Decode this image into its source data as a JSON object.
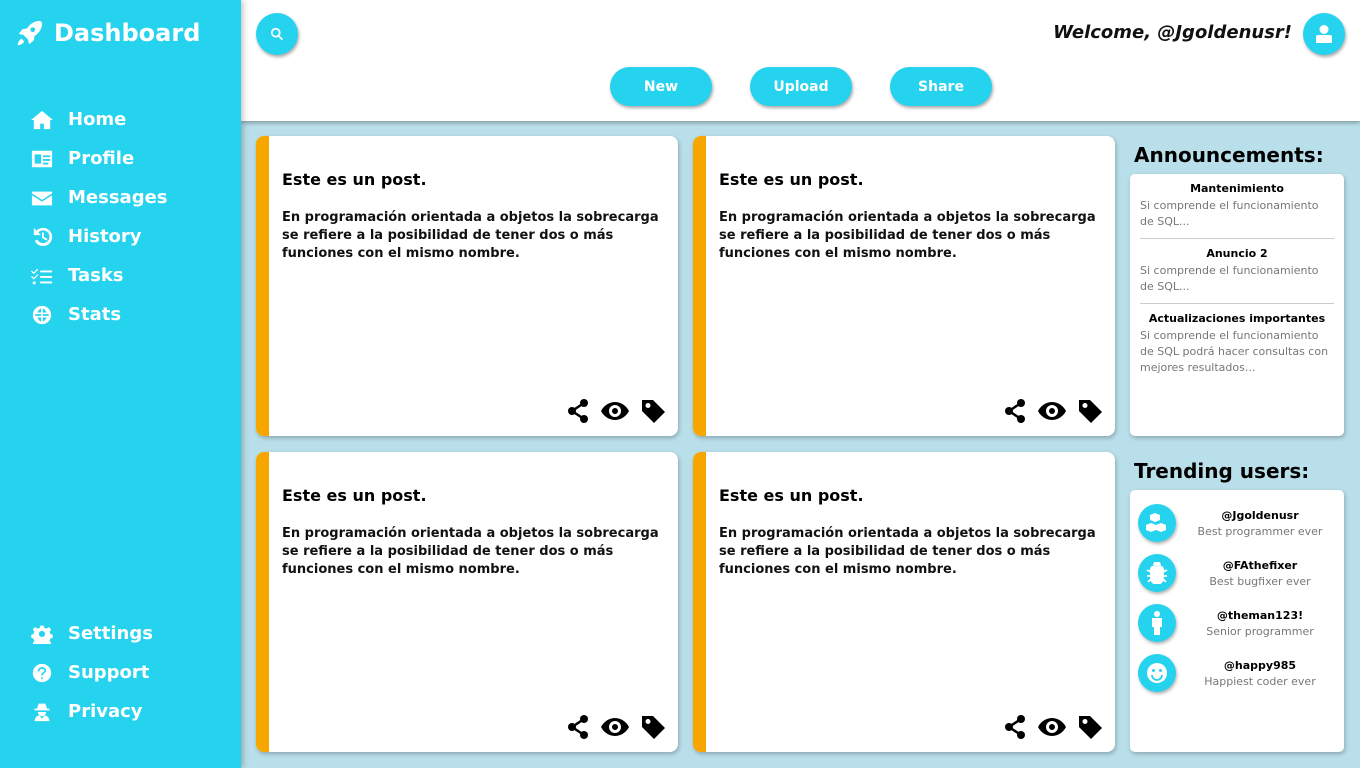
{
  "sidebar": {
    "brand": "Dashboard",
    "items": [
      {
        "label": "Home",
        "icon": "home-icon"
      },
      {
        "label": "Profile",
        "icon": "id-card-icon"
      },
      {
        "label": "Messages",
        "icon": "envelope-icon"
      },
      {
        "label": "History",
        "icon": "history-icon"
      },
      {
        "label": "Tasks",
        "icon": "tasks-icon"
      },
      {
        "label": "Stats",
        "icon": "globe-icon"
      }
    ],
    "bottom_items": [
      {
        "label": "Settings",
        "icon": "gear-icon"
      },
      {
        "label": "Support",
        "icon": "question-icon"
      },
      {
        "label": "Privacy",
        "icon": "user-secret-icon"
      }
    ]
  },
  "header": {
    "welcome": "Welcome, @Jgoldenusr!",
    "buttons": [
      "New",
      "Upload",
      "Share"
    ]
  },
  "posts": [
    {
      "title": "Este es un post.",
      "body": "En programación orientada a objetos la sobrecarga se refiere a la posibilidad de tener dos o más funciones con el mismo nombre."
    },
    {
      "title": "Este es un post.",
      "body": "En programación orientada a objetos la sobrecarga se refiere a la posibilidad de tener dos o más funciones con el mismo nombre."
    },
    {
      "title": "Este es un post.",
      "body": "En programación orientada a objetos la sobrecarga se refiere a la posibilidad de tener dos o más funciones con el mismo nombre."
    },
    {
      "title": "Este es un post.",
      "body": "En programación orientada a objetos la sobrecarga se refiere a la posibilidad de tener dos o más funciones con el mismo nombre."
    }
  ],
  "announcements": {
    "title": "Announcements:",
    "items": [
      {
        "title": "Mantenimiento",
        "desc": "Si comprende el funcionamiento de SQL..."
      },
      {
        "title": "Anuncio 2",
        "desc": "Si comprende el funcionamiento de SQL..."
      },
      {
        "title": "Actualizaciones importantes",
        "desc": "Si comprende el funcionamiento de SQL podrá hacer consultas con mejores resultados..."
      }
    ]
  },
  "trending": {
    "title": "Trending users:",
    "users": [
      {
        "name": "@Jgoldenusr",
        "role": "Best programmer ever",
        "icon": "cubes-icon"
      },
      {
        "name": "@FAthefixer",
        "role": "Best bugfixer ever",
        "icon": "bug-icon"
      },
      {
        "name": "@theman123!",
        "role": "Senior programmer",
        "icon": "person-icon"
      },
      {
        "name": "@happy985",
        "role": "Happiest coder ever",
        "icon": "smile-icon"
      }
    ]
  },
  "colors": {
    "accent": "#26d3ee",
    "stripe": "#f7a600",
    "background": "#b9dfea"
  }
}
